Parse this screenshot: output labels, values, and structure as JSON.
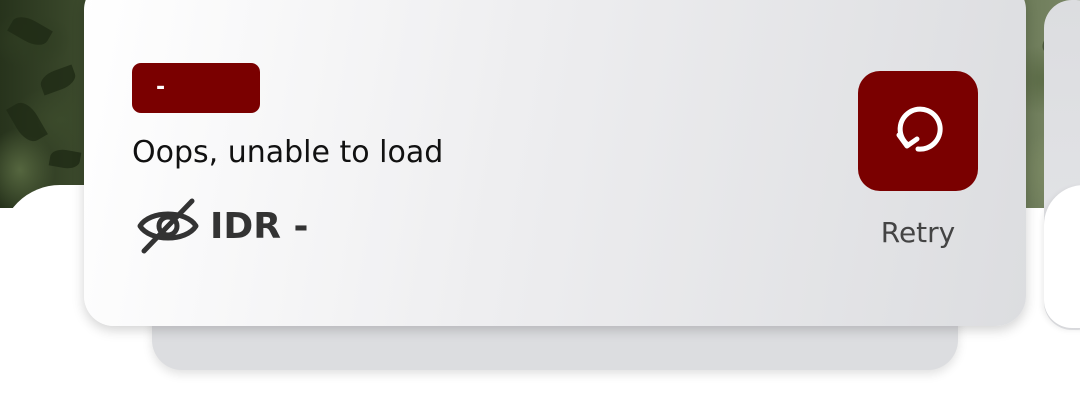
{
  "card": {
    "badge_text": "-",
    "error_message": "Oops, unable to load",
    "balance": {
      "currency": "IDR",
      "amount": "-",
      "visibility_icon": "eye-off-icon"
    },
    "retry": {
      "icon": "refresh-icon",
      "label": "Retry"
    }
  },
  "colors": {
    "accent": "#7a0000",
    "card_start": "#ffffff",
    "card_end": "#dcdde0",
    "text_primary": "#111111",
    "text_secondary": "#444444"
  }
}
